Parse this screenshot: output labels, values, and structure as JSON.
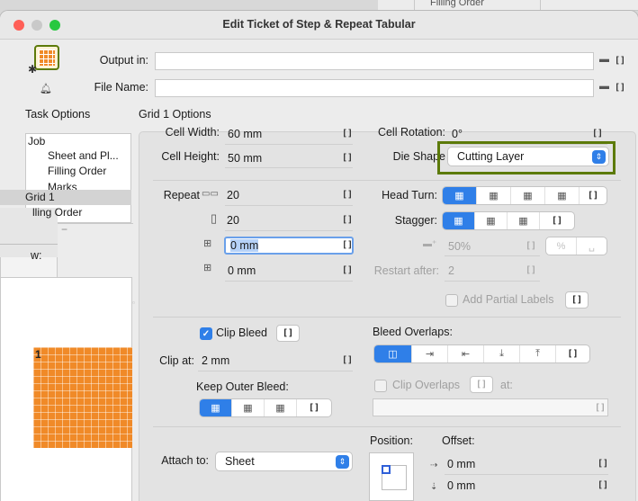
{
  "background_window": {
    "label": "Filling Order"
  },
  "window": {
    "title": "Edit Ticket of Step & Repeat Tabular"
  },
  "header": {
    "output_label": "Output in:",
    "output_value": "",
    "filename_label": "File Name:",
    "filename_value": "",
    "bracket": "[]"
  },
  "task_options": {
    "title": "Task Options",
    "items": [
      "Job",
      "Sheet and Pl...",
      "Filling Order",
      "Marks",
      "Grid 1",
      "lling Order"
    ],
    "selected": "Grid 1",
    "preview_label": "w:",
    "preview_index": "1"
  },
  "grid": {
    "title": "Grid 1 Options",
    "cell_width_label": "Cell Width:",
    "cell_width": "60 mm",
    "cell_height_label": "Cell Height:",
    "cell_height": "50 mm",
    "cell_rotation_label": "Cell Rotation:",
    "cell_rotation": "0°",
    "die_shape_label": "Die Shape",
    "die_shape": "Cutting Layer",
    "repeat_label": "Repeat",
    "repeat_h": "20",
    "repeat_v": "20",
    "gap_h": "0 mm",
    "gap_v": "0 mm",
    "head_turn_label": "Head Turn:",
    "stagger_label": "Stagger:",
    "stagger_value": "50%",
    "percent_label": "%",
    "restart_label": "Restart after:",
    "restart_value": "2",
    "partial_labels": "Add Partial Labels",
    "clip_bleed_label": "Clip Bleed",
    "clip_bleed_checked": true,
    "clip_at_label": "Clip at:",
    "clip_at": "2 mm",
    "keep_outer_bleed_label": "Keep Outer Bleed:",
    "bleed_overlaps_label": "Bleed Overlaps:",
    "clip_overlaps_label": "Clip Overlaps",
    "clip_overlaps_at": "at:",
    "attach_label": "Attach to:",
    "attach_value": "Sheet",
    "position_label": "Position:",
    "offset_label": "Offset:",
    "offset_x": "0 mm",
    "offset_y": "0 mm"
  },
  "colors": {
    "accent": "#2f7fe8",
    "highlight_border": "#5c7a0a",
    "preview_fill": "#f08a28"
  }
}
